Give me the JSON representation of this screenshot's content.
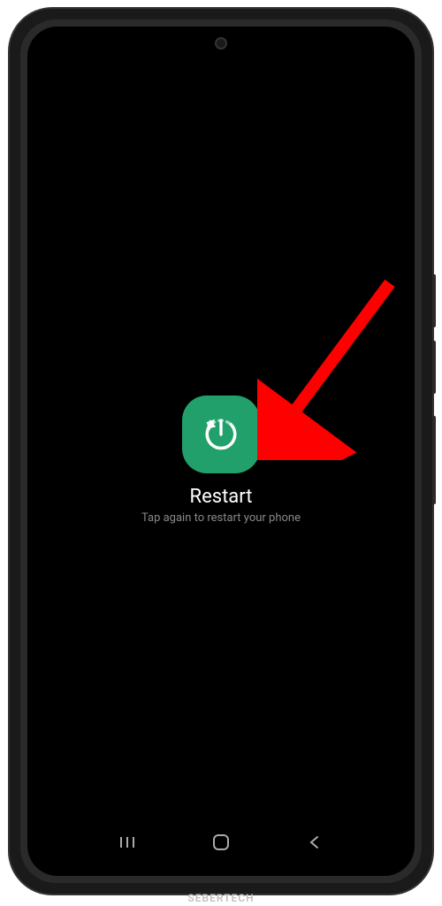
{
  "power_menu": {
    "restart_label": "Restart",
    "restart_hint": "Tap again to restart your phone"
  },
  "colors": {
    "restart_button_bg": "#22a06b",
    "arrow": "#ff0000"
  },
  "watermark": "SEBERTECH"
}
